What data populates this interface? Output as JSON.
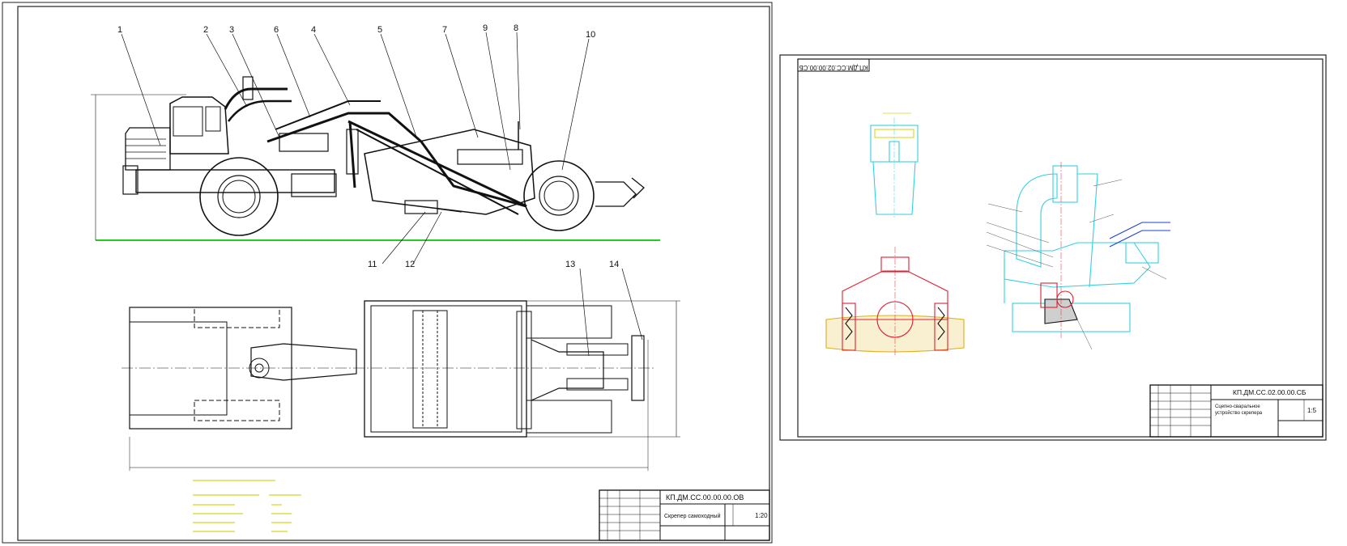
{
  "sheet_left": {
    "callouts": [
      "1",
      "2",
      "3",
      "4",
      "5",
      "6",
      "7",
      "8",
      "9",
      "10",
      "11",
      "12",
      "13",
      "14"
    ],
    "title_block": {
      "designation": "КП.ДМ.СС.00.00.00.ОВ",
      "name": "Скрепер самоходный",
      "scale": "1:20"
    }
  },
  "sheet_right": {
    "stamp_rotated": "КП.ДМ.СС.02.00.00.СБ",
    "title_block": {
      "designation": "КП.ДМ.СС.02.00.00.СБ",
      "name_line1": "Сцепно-сваральное",
      "name_line2": "устройство скрепера",
      "scale": "1:5"
    }
  },
  "colors": {
    "line": "#111111",
    "ground": "#22cc22",
    "cyan": "#33d0e0",
    "red": "#e02030",
    "yellow": "#d8d820",
    "blue": "#2040d0",
    "frame": "#222222"
  }
}
